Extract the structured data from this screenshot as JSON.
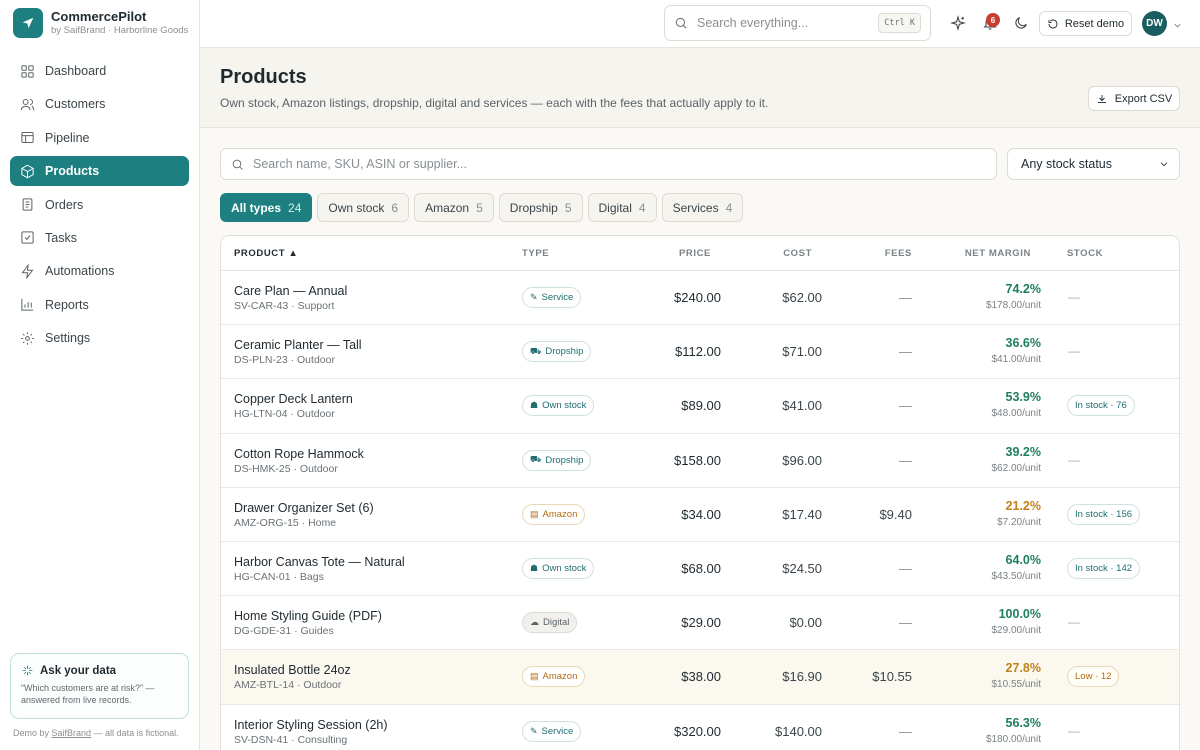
{
  "brand": {
    "name": "CommercePilot",
    "subtitle": "by SaifBrand · Harborline Goods"
  },
  "sidebar": {
    "items": [
      {
        "label": "Dashboard",
        "icon": "grid-icon"
      },
      {
        "label": "Customers",
        "icon": "users-icon"
      },
      {
        "label": "Pipeline",
        "icon": "pipeline-icon"
      },
      {
        "label": "Products",
        "icon": "box-icon",
        "active": true
      },
      {
        "label": "Orders",
        "icon": "document-icon"
      },
      {
        "label": "Tasks",
        "icon": "checkbox-icon"
      },
      {
        "label": "Automations",
        "icon": "lightning-icon"
      },
      {
        "label": "Reports",
        "icon": "bar-chart-icon"
      },
      {
        "label": "Settings",
        "icon": "gear-icon"
      }
    ],
    "ask": {
      "title": "Ask your data",
      "description": "“Which customers are at risk?” — answered from live records."
    },
    "demo_note_prefix": "Demo by ",
    "demo_note_link": "SaifBrand",
    "demo_note_suffix": " — all data is fictional."
  },
  "topbar": {
    "search_placeholder": "Search everything...",
    "shortcut": "Ctrl K",
    "notification_count": "6",
    "reset_label": "Reset demo",
    "avatar_initials": "DW"
  },
  "page": {
    "title": "Products",
    "subtitle": "Own stock, Amazon listings, dropship, digital and services — each with the fees that actually apply to it.",
    "export_label": "Export CSV"
  },
  "filters": {
    "search_placeholder": "Search name, SKU, ASIN or supplier...",
    "stock_status": "Any stock status",
    "chips": [
      {
        "label": "All types",
        "count": "24",
        "active": true
      },
      {
        "label": "Own stock",
        "count": "6"
      },
      {
        "label": "Amazon",
        "count": "5"
      },
      {
        "label": "Dropship",
        "count": "5"
      },
      {
        "label": "Digital",
        "count": "4"
      },
      {
        "label": "Services",
        "count": "4"
      }
    ]
  },
  "table": {
    "headers": {
      "product": "PRODUCT ▲",
      "type": "TYPE",
      "price": "PRICE",
      "cost": "COST",
      "fees": "FEES",
      "net_margin": "NET MARGIN",
      "stock": "STOCK"
    },
    "rows": [
      {
        "name": "Care Plan — Annual",
        "sku": "SV-CAR-43 · Support",
        "type": "Service",
        "type_kind": "service",
        "price": "$240.00",
        "cost": "$62.00",
        "fees": "—",
        "margin": "74.2%",
        "margin_unit": "$178.00/unit",
        "margin_tone": "green",
        "stock": "—",
        "stock_kind": "none"
      },
      {
        "name": "Ceramic Planter — Tall",
        "sku": "DS-PLN-23 · Outdoor",
        "type": "Dropship",
        "type_kind": "dropship",
        "price": "$112.00",
        "cost": "$71.00",
        "fees": "—",
        "margin": "36.6%",
        "margin_unit": "$41.00/unit",
        "margin_tone": "green",
        "stock": "—",
        "stock_kind": "none"
      },
      {
        "name": "Copper Deck Lantern",
        "sku": "HG-LTN-04 · Outdoor",
        "type": "Own stock",
        "type_kind": "own",
        "price": "$89.00",
        "cost": "$41.00",
        "fees": "—",
        "margin": "53.9%",
        "margin_unit": "$48.00/unit",
        "margin_tone": "green",
        "stock": "In stock · 76",
        "stock_kind": "in"
      },
      {
        "name": "Cotton Rope Hammock",
        "sku": "DS-HMK-25 · Outdoor",
        "type": "Dropship",
        "type_kind": "dropship",
        "price": "$158.00",
        "cost": "$96.00",
        "fees": "—",
        "margin": "39.2%",
        "margin_unit": "$62.00/unit",
        "margin_tone": "green",
        "stock": "—",
        "stock_kind": "none"
      },
      {
        "name": "Drawer Organizer Set (6)",
        "sku": "AMZ-ORG-15 · Home",
        "type": "Amazon",
        "type_kind": "amazon",
        "price": "$34.00",
        "cost": "$17.40",
        "fees": "$9.40",
        "margin": "21.2%",
        "margin_unit": "$7.20/unit",
        "margin_tone": "amber",
        "stock": "In stock · 156",
        "stock_kind": "in"
      },
      {
        "name": "Harbor Canvas Tote — Natural",
        "sku": "HG-CAN-01 · Bags",
        "type": "Own stock",
        "type_kind": "own",
        "price": "$68.00",
        "cost": "$24.50",
        "fees": "—",
        "margin": "64.0%",
        "margin_unit": "$43.50/unit",
        "margin_tone": "green",
        "stock": "In stock · 142",
        "stock_kind": "in"
      },
      {
        "name": "Home Styling Guide (PDF)",
        "sku": "DG-GDE-31 · Guides",
        "type": "Digital",
        "type_kind": "digital",
        "price": "$29.00",
        "cost": "$0.00",
        "fees": "—",
        "margin": "100.0%",
        "margin_unit": "$29.00/unit",
        "margin_tone": "green",
        "stock": "—",
        "stock_kind": "none"
      },
      {
        "name": "Insulated Bottle 24oz",
        "sku": "AMZ-BTL-14 · Outdoor",
        "type": "Amazon",
        "type_kind": "amazon",
        "price": "$38.00",
        "cost": "$16.90",
        "fees": "$10.55",
        "margin": "27.8%",
        "margin_unit": "$10.55/unit",
        "margin_tone": "amber",
        "stock": "Low · 12",
        "stock_kind": "low",
        "highlight": true
      },
      {
        "name": "Interior Styling Session (2h)",
        "sku": "SV-DSN-41 · Consulting",
        "type": "Service",
        "type_kind": "service",
        "price": "$320.00",
        "cost": "$140.00",
        "fees": "—",
        "margin": "56.3%",
        "margin_unit": "$180.00/unit",
        "margin_tone": "green",
        "stock": "—",
        "stock_kind": "none"
      }
    ]
  }
}
